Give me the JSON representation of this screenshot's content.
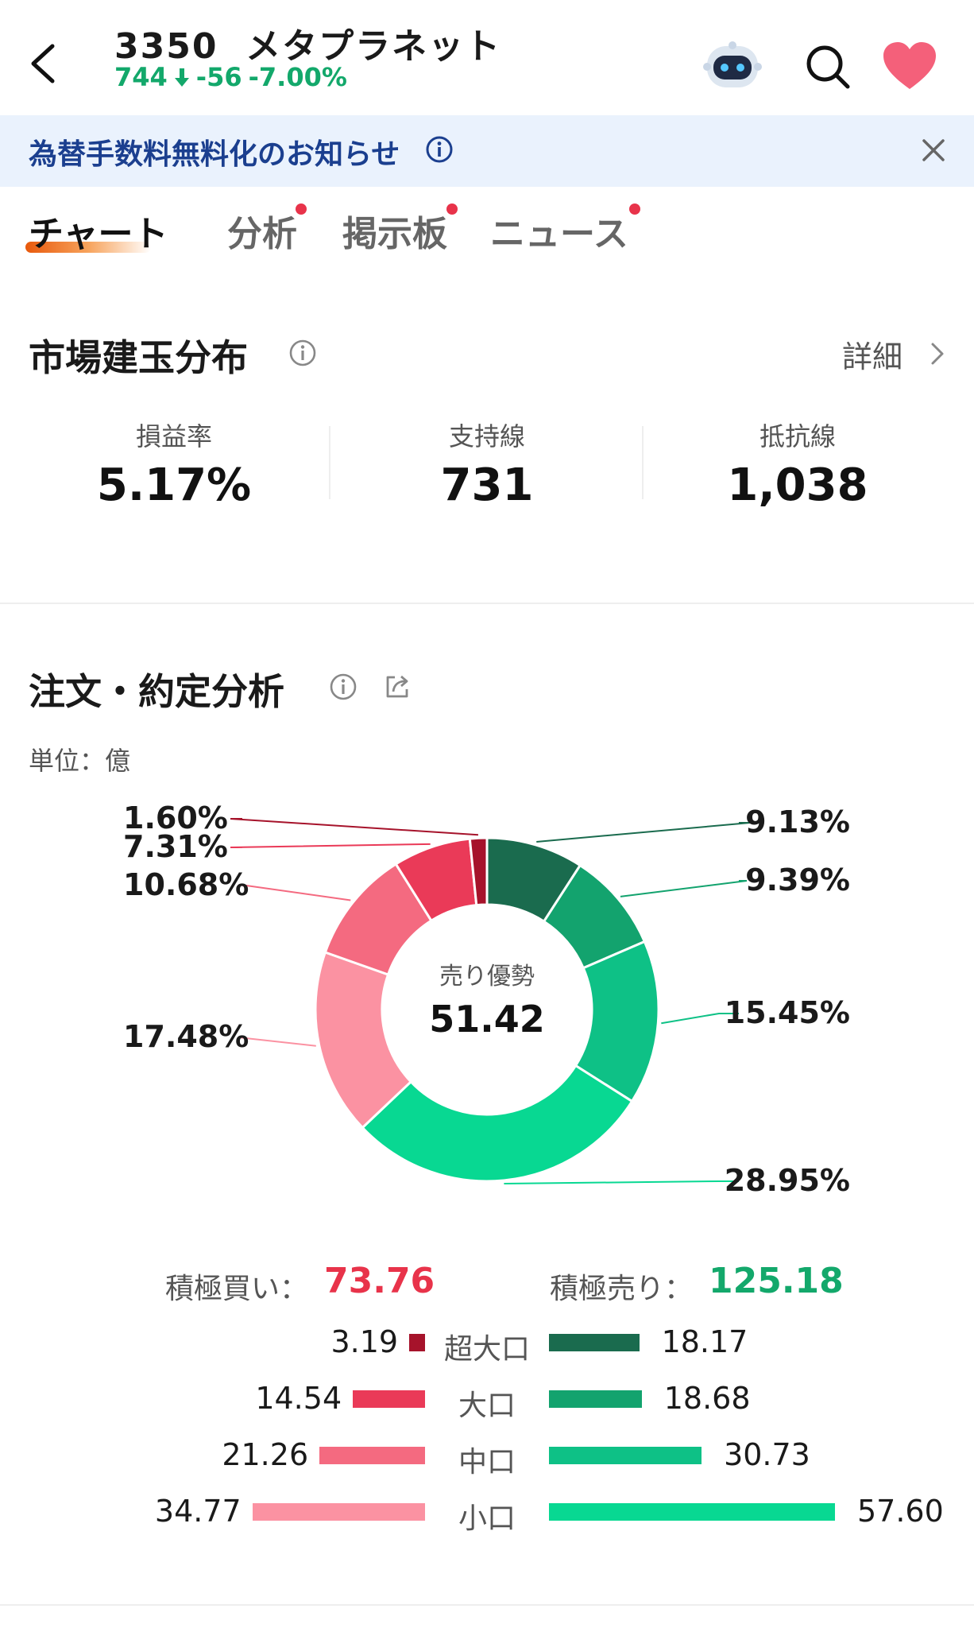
{
  "header": {
    "code": "3350",
    "name": "メタプラネット",
    "price": "744",
    "change": "-56",
    "change_pct": "-7.00%"
  },
  "banner": {
    "text": "為替手数料無料化のお知らせ"
  },
  "tabs": [
    {
      "label": "チャート",
      "active": true,
      "dot": false
    },
    {
      "label": "分析",
      "active": false,
      "dot": true
    },
    {
      "label": "掲示板",
      "active": false,
      "dot": true
    },
    {
      "label": "ニュース",
      "active": false,
      "dot": true
    }
  ],
  "market_position": {
    "title": "市場建玉分布",
    "detail_label": "詳細",
    "stats": [
      {
        "label": "損益率",
        "value": "5.17%"
      },
      {
        "label": "支持線",
        "value": "731"
      },
      {
        "label": "抵抗線",
        "value": "1,038"
      }
    ]
  },
  "order_analysis": {
    "title": "注文・約定分析",
    "unit": "単位：億",
    "center_label": "売り優勢",
    "center_value": "51.42",
    "buy_total_label": "積極買い：",
    "buy_total_value": "73.76",
    "sell_total_label": "積極売り：",
    "sell_total_value": "125.18",
    "rows": [
      {
        "category": "超大口",
        "buy": "3.19",
        "sell": "18.17"
      },
      {
        "category": "大口",
        "buy": "14.54",
        "sell": "18.68"
      },
      {
        "category": "中口",
        "buy": "21.26",
        "sell": "30.73"
      },
      {
        "category": "小口",
        "buy": "34.77",
        "sell": "57.60"
      }
    ]
  },
  "chart_data": {
    "type": "pie",
    "donut": true,
    "slices": [
      {
        "label": "9.13%",
        "value": 9.13,
        "side": "sell",
        "category": "超大口",
        "color": "#1a6b4e"
      },
      {
        "label": "9.39%",
        "value": 9.39,
        "side": "sell",
        "category": "大口",
        "color": "#13a36e"
      },
      {
        "label": "15.45%",
        "value": 15.45,
        "side": "sell",
        "category": "中口",
        "color": "#0ec186"
      },
      {
        "label": "28.95%",
        "value": 28.95,
        "side": "sell",
        "category": "小口",
        "color": "#08d892"
      },
      {
        "label": "17.48%",
        "value": 17.48,
        "side": "buy",
        "category": "小口",
        "color": "#fb92a2"
      },
      {
        "label": "10.68%",
        "value": 10.68,
        "side": "buy",
        "category": "中口",
        "color": "#f46a80"
      },
      {
        "label": "7.31%",
        "value": 7.31,
        "side": "buy",
        "category": "大口",
        "color": "#ea3a58"
      },
      {
        "label": "1.60%",
        "value": 1.6,
        "side": "buy",
        "category": "超大口",
        "color": "#a6132b"
      }
    ]
  },
  "colors": {
    "up_red": "#e8334a",
    "down_green": "#13a86b",
    "banner_bg": "#eaf2fd",
    "banner_text": "#1b3f8f",
    "heart": "#f4607a"
  }
}
